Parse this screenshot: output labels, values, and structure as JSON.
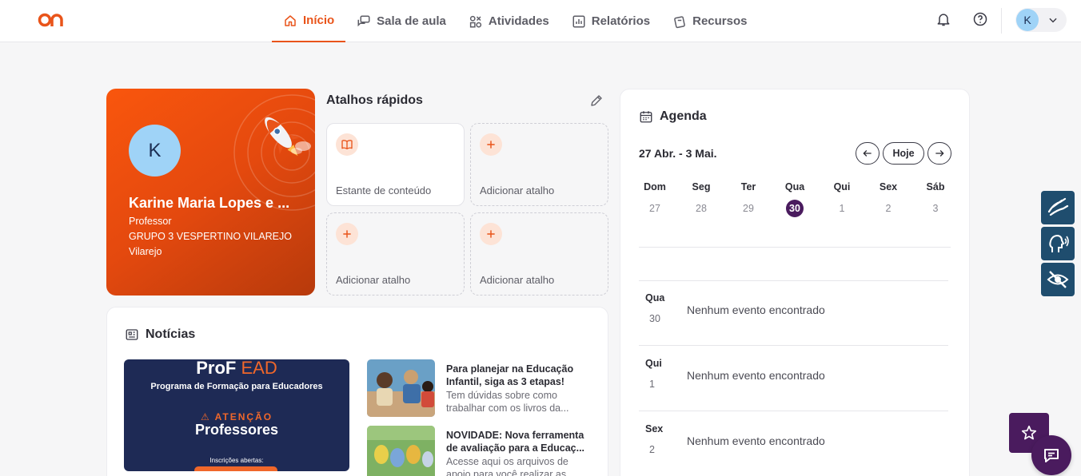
{
  "nav": {
    "items": [
      {
        "label": "Início",
        "icon": "home-icon",
        "active": true
      },
      {
        "label": "Sala de aula",
        "icon": "chat-bubbles-icon",
        "active": false
      },
      {
        "label": "Atividades",
        "icon": "activities-icon",
        "active": false
      },
      {
        "label": "Relatórios",
        "icon": "report-chart-icon",
        "active": false
      },
      {
        "label": "Recursos",
        "icon": "resources-icon",
        "active": false
      }
    ],
    "avatar_initial": "K"
  },
  "profile": {
    "initial": "K",
    "name": "Karine Maria Lopes e ...",
    "role": "Professor",
    "group": "GRUPO 3 VESPERTINO VILAREJO",
    "unit": "Vilarejo"
  },
  "shortcuts": {
    "title": "Atalhos rápidos",
    "items": [
      {
        "label": "Estante de conteúdo",
        "icon": "open-book-icon"
      },
      {
        "label": "Adicionar atalho",
        "icon": "plus-icon"
      },
      {
        "label": "Adicionar atalho",
        "icon": "plus-icon"
      },
      {
        "label": "Adicionar atalho",
        "icon": "plus-icon"
      }
    ]
  },
  "news": {
    "title": "Notícias",
    "banner": {
      "brand": "ProF",
      "brand_suffix": "EAD",
      "subtitle": "Programa de Formação para Educadores",
      "warning": "ATENÇÃO",
      "audience": "Professores",
      "footer": "Inscrições abertas:"
    },
    "items": [
      {
        "title": "Para planejar na Educação Infantil, siga as 3 etapas!",
        "desc": "Tem dúvidas sobre como trabalhar com os livros da..."
      },
      {
        "title": "NOVIDADE: Nova ferramenta de avaliação para a Educaç...",
        "desc": "Acesse aqui os arquivos de apoio para você realizar as..."
      }
    ]
  },
  "agenda": {
    "title": "Agenda",
    "range": "27 Abr. - 3 Mai.",
    "today_label": "Hoje",
    "week": [
      {
        "name": "Dom",
        "day": "27"
      },
      {
        "name": "Seg",
        "day": "28"
      },
      {
        "name": "Ter",
        "day": "29"
      },
      {
        "name": "Qua",
        "day": "30",
        "today": true
      },
      {
        "name": "Qui",
        "day": "1"
      },
      {
        "name": "Sex",
        "day": "2"
      },
      {
        "name": "Sáb",
        "day": "3"
      }
    ],
    "events": [
      {
        "day_name": "Qua",
        "day": "30",
        "message": "Nenhum evento encontrado"
      },
      {
        "day_name": "Qui",
        "day": "1",
        "message": "Nenhum evento encontrado"
      },
      {
        "day_name": "Sex",
        "day": "2",
        "message": "Nenhum evento encontrado"
      }
    ]
  },
  "colors": {
    "accent": "#e9541a",
    "primary_dark": "#4a1b5e",
    "a11y": "#1f4d6e"
  }
}
